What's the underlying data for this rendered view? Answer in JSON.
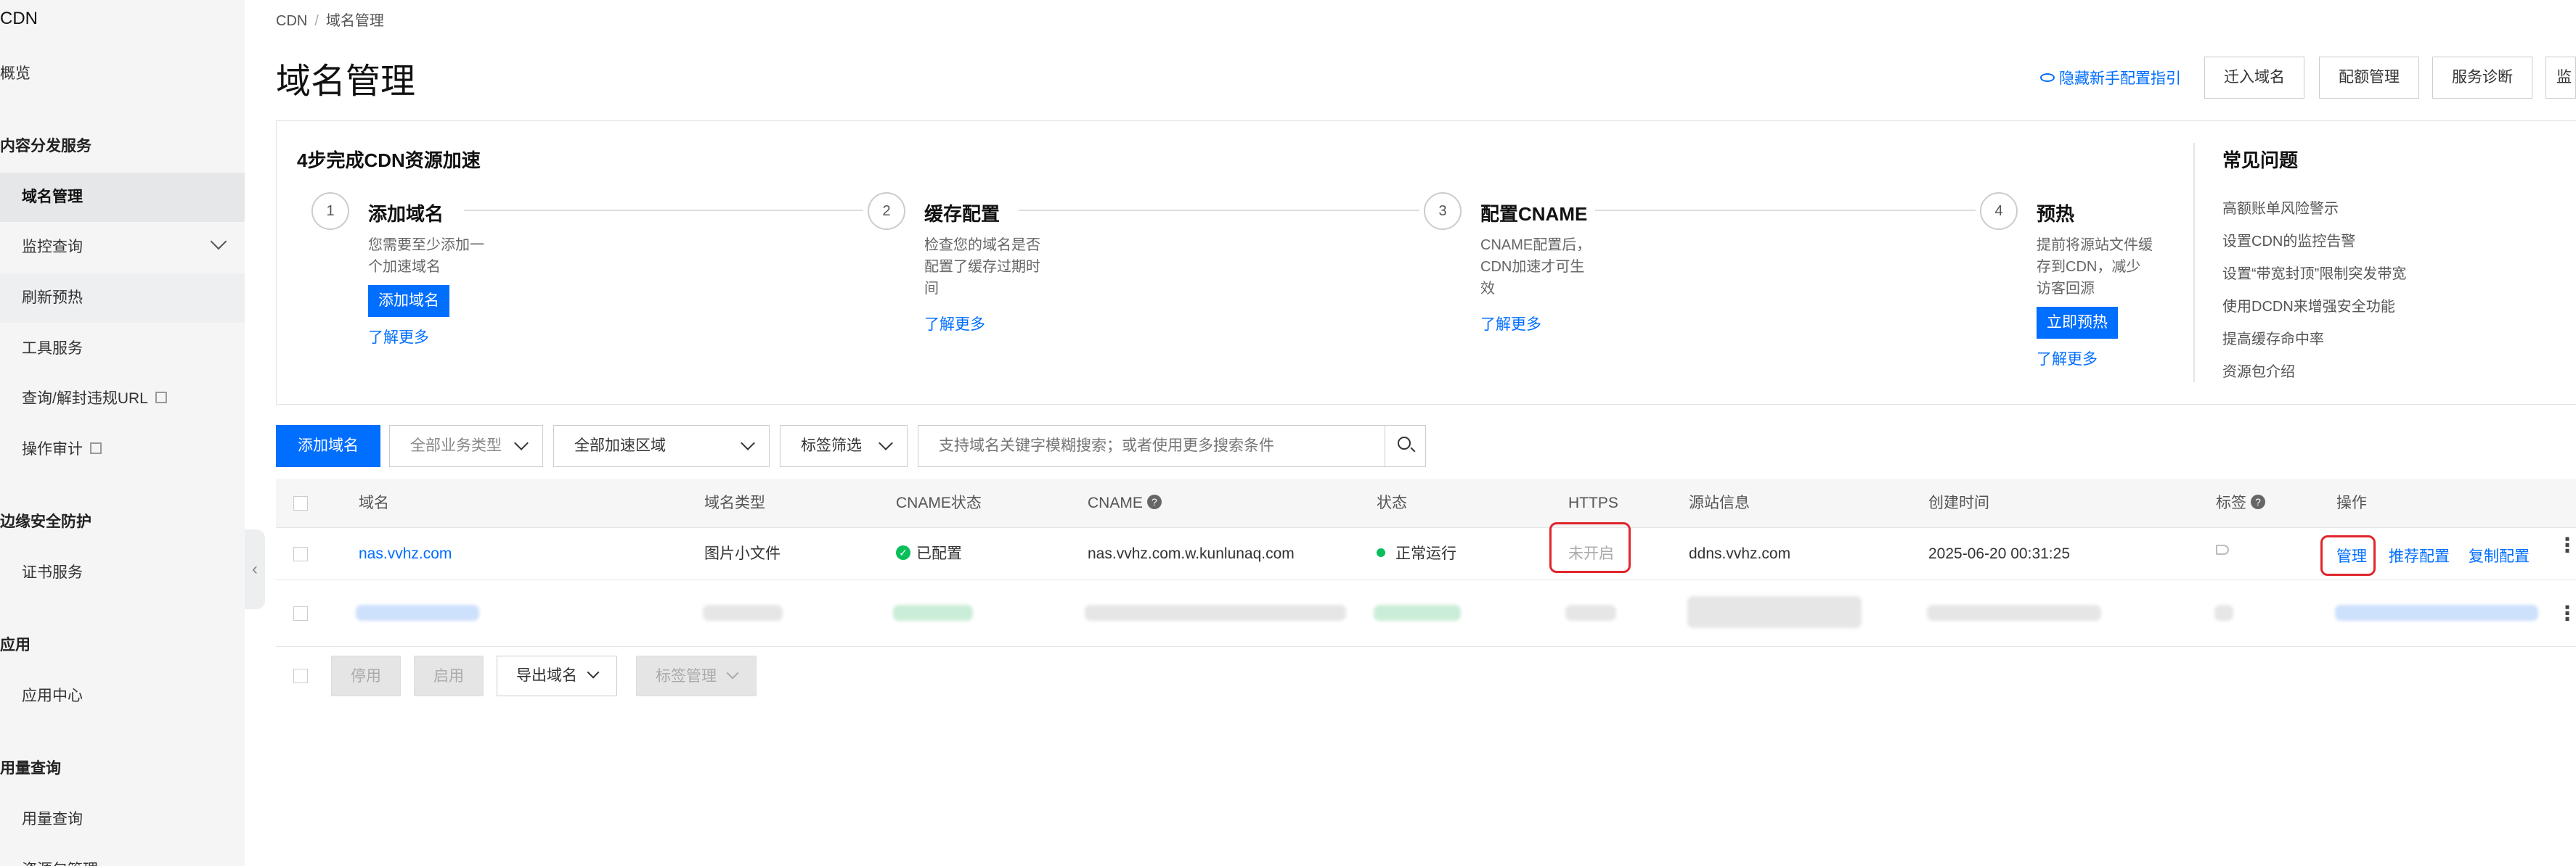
{
  "sidebar": {
    "title": "CDN",
    "items": [
      {
        "label": "概览"
      },
      {
        "label": "内容分发服务"
      },
      {
        "label": "域名管理"
      },
      {
        "label": "监控查询"
      },
      {
        "label": "刷新预热"
      },
      {
        "label": "工具服务"
      },
      {
        "label": "查询/解封违规URL"
      },
      {
        "label": "操作审计"
      },
      {
        "label": "边缘安全防护"
      },
      {
        "label": "证书服务"
      },
      {
        "label": "应用"
      },
      {
        "label": "应用中心"
      },
      {
        "label": "用量查询"
      },
      {
        "label": "用量查询"
      },
      {
        "label": "资源包管理"
      }
    ]
  },
  "breadcrumb": {
    "root": "CDN",
    "sep": "/",
    "current": "域名管理"
  },
  "page_title": "域名管理",
  "header": {
    "guide_link": "隐藏新手配置指引",
    "buttons": [
      "迁入域名",
      "配额管理",
      "服务诊断",
      "监"
    ]
  },
  "steps_card": {
    "title": "4步完成CDN资源加速",
    "steps": [
      {
        "num": "1",
        "title": "添加域名",
        "desc_lines": [
          "您需要至少添加一",
          "个加速域名"
        ],
        "button": "添加域名",
        "link": "了解更多"
      },
      {
        "num": "2",
        "title": "缓存配置",
        "desc_lines": [
          "检查您的域名是否",
          "配置了缓存过期时",
          "间"
        ],
        "link": "了解更多"
      },
      {
        "num": "3",
        "title": "配置CNAME",
        "desc_lines": [
          "CNAME配置后，",
          "CDN加速才可生",
          "效"
        ],
        "link": "了解更多"
      },
      {
        "num": "4",
        "title": "预热",
        "desc_lines": [
          "提前将源站文件缓",
          "存到CDN，减少",
          "访客回源"
        ],
        "button": "立即预热",
        "link": "了解更多"
      }
    ],
    "faq": {
      "title": "常见问题",
      "items": [
        "高额账单风险警示",
        "设置CDN的监控告警",
        "设置“带宽封顶”限制突发带宽",
        "使用DCDN来增强安全功能",
        "提高缓存命中率",
        "资源包介绍"
      ]
    }
  },
  "toolbar": {
    "add_domain": "添加域名",
    "business_type": "全部业务类型",
    "region": "全部加速区域",
    "tag_filter": "标签筛选",
    "search_placeholder": "支持域名关键字模糊搜索；或者使用更多搜索条件"
  },
  "table": {
    "headers": [
      "域名",
      "域名类型",
      "CNAME状态",
      "CNAME",
      "状态",
      "HTTPS",
      "源站信息",
      "创建时间",
      "标签",
      "操作"
    ],
    "rows": [
      {
        "domain": "nas.vvhz.com",
        "type": "图片小文件",
        "cname_status": "已配置",
        "cname": "nas.vvhz.com.w.kunlunaq.com",
        "status": "正常运行",
        "https": "未开启",
        "origin": "ddns.vvhz.com",
        "created": "2025-06-20 00:31:25",
        "actions": [
          "管理",
          "推荐配置",
          "复制配置"
        ]
      }
    ]
  },
  "bulk": {
    "disable": "停用",
    "enable": "启用",
    "export": "导出域名",
    "tag_manage": "标签管理"
  },
  "colors": {
    "primary": "#006eff",
    "success": "#0abf5b",
    "highlight": "#e0262d",
    "sidebar_bg": "#f5f5f6"
  }
}
